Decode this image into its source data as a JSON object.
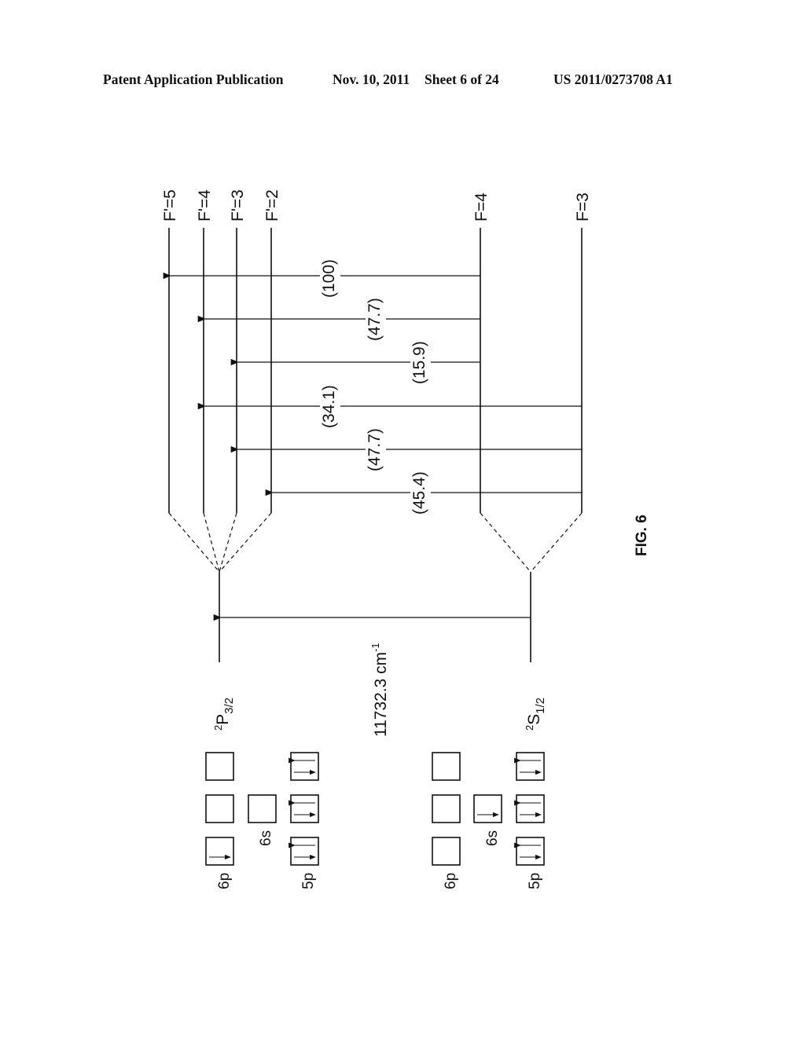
{
  "header": {
    "publication": "Patent Application Publication",
    "date": "Nov. 10, 2011",
    "sheet": "Sheet 6 of 24",
    "number": "US 2011/0273708 A1"
  },
  "figure": {
    "label": "FIG. 6",
    "upper_state": {
      "base": "2",
      "letter": "P",
      "sub": "3/2"
    },
    "lower_state": {
      "base": "2",
      "letter": "S",
      "sub": "1/2"
    },
    "main_transition": {
      "value": "11732.3 cm",
      "exp": "-1"
    },
    "upper_levels": [
      "F'=5",
      "F'=4",
      "F'=3",
      "F'=2"
    ],
    "lower_levels": [
      "F=4",
      "F=3"
    ],
    "transitions": [
      {
        "from": "F=4",
        "to": "F'=5",
        "label": "(100)"
      },
      {
        "from": "F=4",
        "to": "F'=4",
        "label": "(47.7)"
      },
      {
        "from": "F=4",
        "to": "F'=3",
        "label": "(15.9)"
      },
      {
        "from": "F=3",
        "to": "F'=4",
        "label": "(34.1)"
      },
      {
        "from": "F=3",
        "to": "F'=3",
        "label": "(47.7)"
      },
      {
        "from": "F=3",
        "to": "F'=2",
        "label": "(45.4)"
      }
    ],
    "orbital_labels": {
      "p6": "6p",
      "s6": "6s",
      "p5": "5p"
    }
  }
}
